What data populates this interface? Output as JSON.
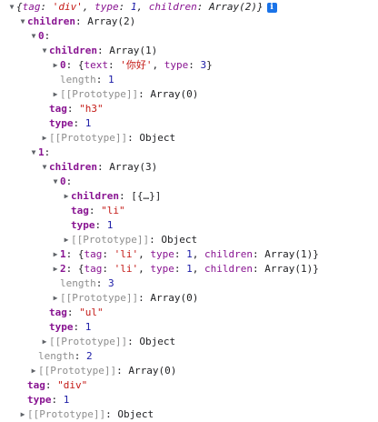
{
  "root": {
    "summary": {
      "open": "{",
      "k1": "tag",
      "colon": ": ",
      "v1": "'div'",
      "sep1": ", ",
      "k2": "type",
      "v2": "1",
      "sep2": ", ",
      "k3": "children",
      "v3": "Array(2)",
      "close": "}"
    },
    "info_icon": "i"
  },
  "lines": {
    "l1": {
      "key": "children",
      "val": "Array(2)"
    },
    "l2": {
      "key": "0"
    },
    "l3": {
      "key": "children",
      "val": "Array(1)"
    },
    "l4": {
      "key": "0",
      "open": "{",
      "k1": "text",
      "v1": "'你好'",
      "k2": "type",
      "v2": "3",
      "close": "}"
    },
    "l5": {
      "key": "length",
      "val": "1"
    },
    "l6": {
      "key": "[[Prototype]]",
      "val": "Array(0)"
    },
    "l7": {
      "key": "tag",
      "val": "\"h3\""
    },
    "l8": {
      "key": "type",
      "val": "1"
    },
    "l9": {
      "key": "[[Prototype]]",
      "val": "Object"
    },
    "l10": {
      "key": "1"
    },
    "l11": {
      "key": "children",
      "val": "Array(3)"
    },
    "l12": {
      "key": "0"
    },
    "l13": {
      "key": "children",
      "val": "[{…}]"
    },
    "l14": {
      "key": "tag",
      "val": "\"li\""
    },
    "l15": {
      "key": "type",
      "val": "1"
    },
    "l16": {
      "key": "[[Prototype]]",
      "val": "Object"
    },
    "l17": {
      "key": "1",
      "open": "{",
      "k1": "tag",
      "v1": "'li'",
      "k2": "type",
      "v2": "1",
      "k3": "children",
      "v3": "Array(1)",
      "close": "}"
    },
    "l18": {
      "key": "2",
      "open": "{",
      "k1": "tag",
      "v1": "'li'",
      "k2": "type",
      "v2": "1",
      "k3": "children",
      "v3": "Array(1)",
      "close": "}"
    },
    "l19": {
      "key": "length",
      "val": "3"
    },
    "l20": {
      "key": "[[Prototype]]",
      "val": "Array(0)"
    },
    "l21": {
      "key": "tag",
      "val": "\"ul\""
    },
    "l22": {
      "key": "type",
      "val": "1"
    },
    "l23": {
      "key": "[[Prototype]]",
      "val": "Object"
    },
    "l24": {
      "key": "length",
      "val": "2"
    },
    "l25": {
      "key": "[[Prototype]]",
      "val": "Array(0)"
    },
    "l26": {
      "key": "tag",
      "val": "\"div\""
    },
    "l27": {
      "key": "type",
      "val": "1"
    },
    "l28": {
      "key": "[[Prototype]]",
      "val": "Object"
    }
  },
  "punct": {
    "colon": ": ",
    "comma": ", "
  },
  "colors": {
    "key": "#881391",
    "string": "#c41a16",
    "number": "#1a1aa6",
    "info": "#1a73e8"
  },
  "icons": {
    "expanded": "triangle-down-icon",
    "collapsed": "triangle-right-icon"
  }
}
